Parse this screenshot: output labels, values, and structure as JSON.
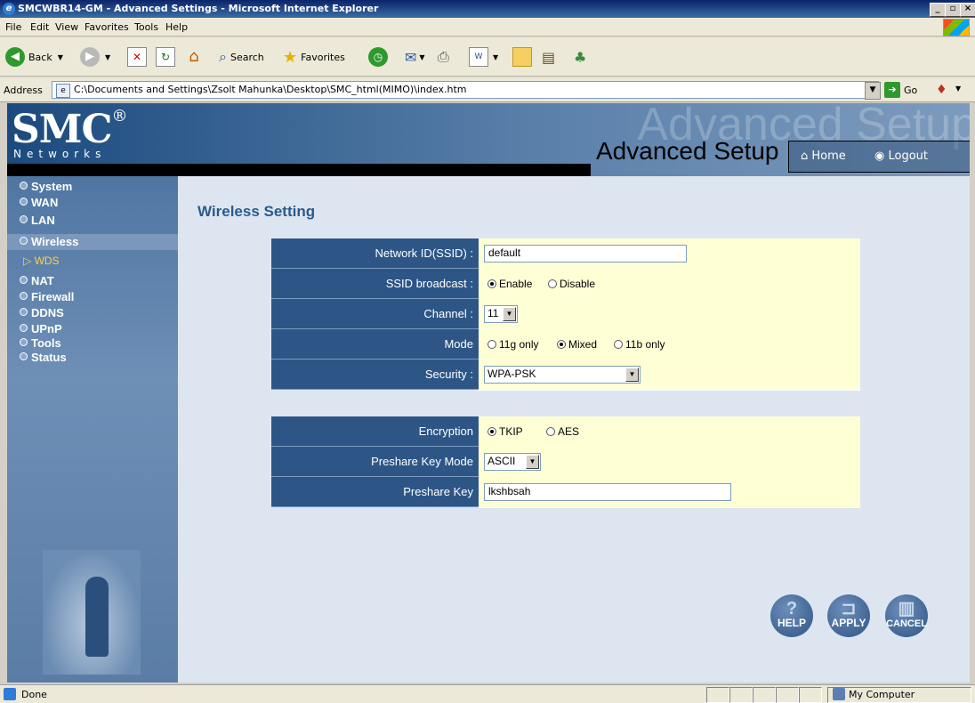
{
  "window": {
    "title": "SMCWBR14-GM - Advanced Settings - Microsoft Internet Explorer",
    "controls": [
      "_",
      "▫",
      "×"
    ]
  },
  "menu": [
    "File",
    "Edit",
    "View",
    "Favorites",
    "Tools",
    "Help"
  ],
  "toolbar": {
    "back": "Back",
    "search": "Search",
    "favorites": "Favorites"
  },
  "address": {
    "label": "Address",
    "url": "C:\\Documents and Settings\\Zsolt Mahunka\\Desktop\\SMC_html(MIMO)\\index.htm",
    "go": "Go"
  },
  "header": {
    "logo": "SMC",
    "logo_mark": "®",
    "logo_sub": "Networks",
    "watermark": "Advanced Setup",
    "title": "Advanced Setup",
    "home": "Home",
    "logout": "Logout"
  },
  "sidebar": {
    "items": [
      "System",
      "WAN",
      "LAN",
      "Wireless",
      "NAT",
      "Firewall",
      "DDNS",
      "UPnP",
      "Tools",
      "Status"
    ],
    "sub_items": [
      "WDS"
    ]
  },
  "content": {
    "title": "Wireless Setting",
    "ssid_label": "Network ID(SSID) :",
    "ssid_value": "default",
    "broadcast_label": "SSID broadcast :",
    "broadcast_options": [
      "Enable",
      "Disable"
    ],
    "channel_label": "Channel :",
    "channel_value": "11",
    "mode_label": "Mode",
    "mode_options": [
      "11g only",
      "Mixed",
      "11b only"
    ],
    "security_label": "Security :",
    "security_value": "WPA-PSK",
    "encryption_label": "Encryption",
    "encryption_options": [
      "TKIP",
      "AES"
    ],
    "psk_mode_label": "Preshare Key Mode",
    "psk_mode_value": "ASCII",
    "psk_label": "Preshare Key",
    "psk_value": "lkshbsah"
  },
  "buttons": {
    "help": "HELP",
    "apply": "APPLY",
    "cancel": "CANCEL"
  },
  "status": {
    "text": "Done",
    "zone": "My Computer"
  }
}
